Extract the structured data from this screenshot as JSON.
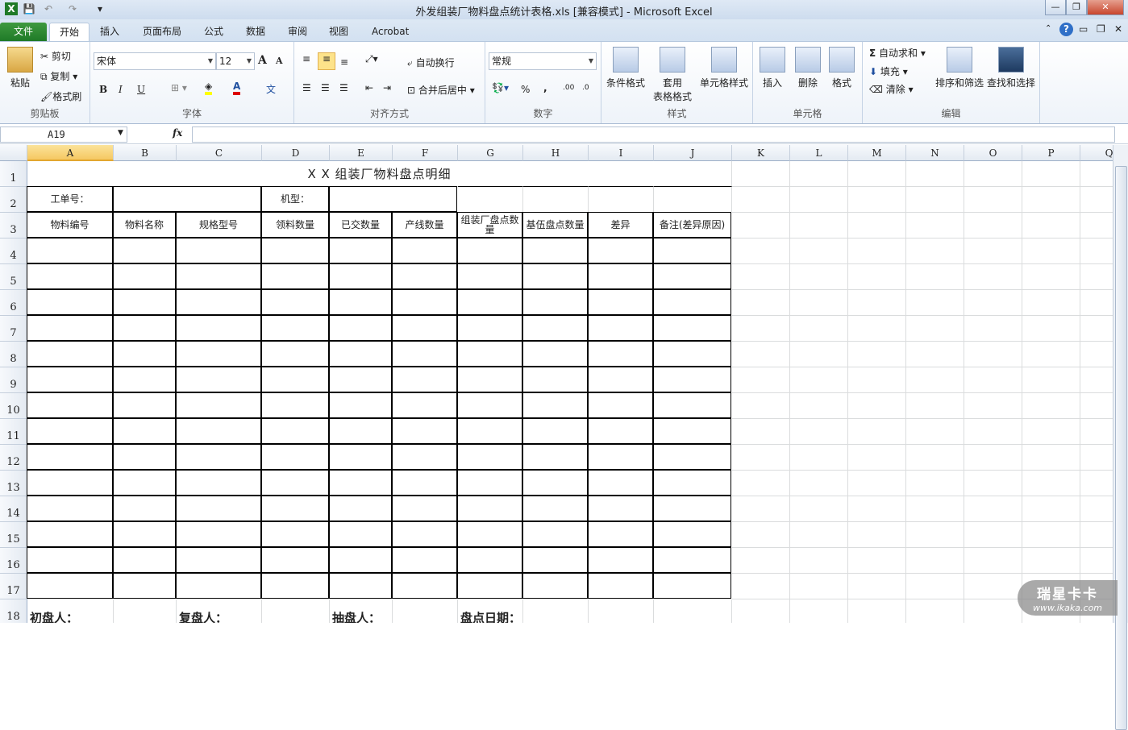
{
  "window": {
    "title": "外发组装厂物料盘点统计表格.xls  [兼容模式] - Microsoft Excel",
    "min": "—",
    "restore": "❐",
    "close": "✕"
  },
  "tabs": [
    {
      "label": "文件"
    },
    {
      "label": "开始"
    },
    {
      "label": "插入"
    },
    {
      "label": "页面布局"
    },
    {
      "label": "公式"
    },
    {
      "label": "数据"
    },
    {
      "label": "审阅"
    },
    {
      "label": "视图"
    },
    {
      "label": "Acrobat"
    }
  ],
  "ribbon": {
    "clipboard": {
      "label": "剪贴板",
      "paste": "粘贴",
      "cut": "剪切",
      "copy": "复制",
      "format_painter": "格式刷"
    },
    "font": {
      "label": "字体",
      "name": "宋体",
      "size": "12",
      "grow": "A",
      "shrink": "A",
      "bold": "B",
      "italic": "I",
      "underline": "U",
      "phonetic": "文"
    },
    "align": {
      "label": "对齐方式",
      "wrap": "自动换行",
      "merge": "合并后居中"
    },
    "number": {
      "label": "数字",
      "format": "常规",
      "percent": "%",
      "comma": ",",
      "inc": ".00",
      "dec": ".0"
    },
    "styles": {
      "label": "样式",
      "conditional": "条件格式",
      "table1": "套用",
      "table2": "表格格式",
      "cell": "单元格样式"
    },
    "cells": {
      "label": "单元格",
      "insert": "插入",
      "delete": "删除",
      "format": "格式"
    },
    "editing": {
      "label": "编辑",
      "autosum": "自动求和",
      "fill": "填充",
      "clear": "清除",
      "sort": "排序和筛选",
      "find": "查找和选择"
    }
  },
  "formula_bar": {
    "name_box": "A19",
    "fx": "fx",
    "value": ""
  },
  "columns": [
    "A",
    "B",
    "C",
    "D",
    "E",
    "F",
    "G",
    "H",
    "I",
    "J",
    "K",
    "L",
    "M",
    "N",
    "O",
    "P",
    "Q"
  ],
  "selected_column": "A",
  "rows": [
    "1",
    "2",
    "3",
    "4",
    "5",
    "6",
    "7",
    "8",
    "9",
    "10",
    "11",
    "12",
    "13",
    "14",
    "15",
    "16",
    "17",
    "18"
  ],
  "sheet": {
    "title": "X X 组装厂物料盘点明细",
    "order_label": "工单号：",
    "model_label": "机型：",
    "headers": [
      "物料编号",
      "物料名称",
      "规格型号",
      "领料数量",
      "已交数量",
      "产线数量",
      "组装厂盘点数量",
      "基伍盘点数量",
      "差异",
      "备注(差异原因)"
    ],
    "signatures": [
      "初盘人：",
      "复盘人：",
      "抽盘人：",
      "盘点日期："
    ]
  },
  "watermark": {
    "brand": "瑞星卡卡",
    "url": "www.ikaka.com"
  }
}
